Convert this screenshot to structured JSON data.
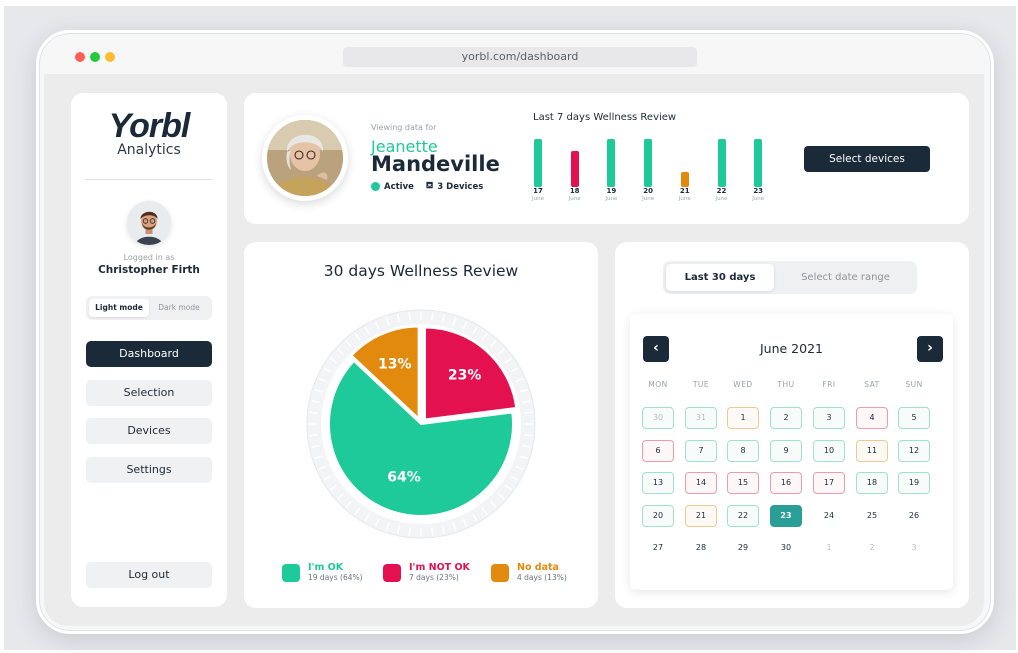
{
  "browser": {
    "url": "yorbl.com/dashboard"
  },
  "colors": {
    "ok": "#1ec99a",
    "not_ok": "#e3114f",
    "no_data": "#e18a0d",
    "navy": "#1b2a38",
    "today": "#2a9f97"
  },
  "sidebar": {
    "logo_mark": "Yorbl",
    "logo_sub": "Analytics",
    "logged_label": "Logged in as",
    "user_name": "Christopher Firth",
    "modes": {
      "light": "Light mode",
      "dark": "Dark mode",
      "selected": "light"
    },
    "nav": [
      {
        "label": "Dashboard",
        "active": true
      },
      {
        "label": "Selection",
        "active": false
      },
      {
        "label": "Devices",
        "active": false
      },
      {
        "label": "Settings",
        "active": false
      }
    ],
    "logout": "Log out"
  },
  "profile": {
    "viewing_label": "Viewing data for",
    "first_name": "Jeanette",
    "last_name": "Mandeville",
    "status": "Active",
    "devices": "3 Devices"
  },
  "week_review": {
    "title": "Last 7 days Wellness Review",
    "days": [
      {
        "day": "17",
        "month": "June",
        "status": "ok"
      },
      {
        "day": "18",
        "month": "June",
        "status": "not_ok"
      },
      {
        "day": "19",
        "month": "June",
        "status": "ok"
      },
      {
        "day": "20",
        "month": "June",
        "status": "ok"
      },
      {
        "day": "21",
        "month": "June",
        "status": "no_data"
      },
      {
        "day": "22",
        "month": "June",
        "status": "ok"
      },
      {
        "day": "23",
        "month": "June",
        "status": "ok"
      }
    ],
    "select_devices": "Select devices"
  },
  "chart_data": {
    "type": "pie",
    "title": "30 days Wellness Review",
    "slices": [
      {
        "label": "I'm OK",
        "value": 64,
        "display": "64%",
        "sub": "19 days (64%)",
        "color": "#1ec99a"
      },
      {
        "label": "I'm NOT OK",
        "value": 23,
        "display": "23%",
        "sub": "7 days (23%)",
        "color": "#e3114f"
      },
      {
        "label": "No data",
        "value": 13,
        "display": "13%",
        "sub": "4 days (13%)",
        "color": "#e18a0d"
      }
    ]
  },
  "calendar": {
    "range_active": "Last 30 days",
    "range_other": "Select date range",
    "month": "June 2021",
    "weekdays": [
      "MON",
      "TUE",
      "WED",
      "THU",
      "FRI",
      "SAT",
      "SUN"
    ],
    "weeks": [
      [
        {
          "d": "30",
          "s": "ok",
          "m": true
        },
        {
          "d": "31",
          "s": "ok",
          "m": true
        },
        {
          "d": "1",
          "s": "nodata"
        },
        {
          "d": "2",
          "s": "ok"
        },
        {
          "d": "3",
          "s": "ok"
        },
        {
          "d": "4",
          "s": "notok"
        },
        {
          "d": "5",
          "s": "ok"
        }
      ],
      [
        {
          "d": "6",
          "s": "notok"
        },
        {
          "d": "7",
          "s": "ok"
        },
        {
          "d": "8",
          "s": "ok"
        },
        {
          "d": "9",
          "s": "ok"
        },
        {
          "d": "10",
          "s": "ok"
        },
        {
          "d": "11",
          "s": "nodata"
        },
        {
          "d": "12",
          "s": "ok"
        }
      ],
      [
        {
          "d": "13",
          "s": "ok"
        },
        {
          "d": "14",
          "s": "notok"
        },
        {
          "d": "15",
          "s": "notok"
        },
        {
          "d": "16",
          "s": "notok"
        },
        {
          "d": "17",
          "s": "notok"
        },
        {
          "d": "18",
          "s": "ok"
        },
        {
          "d": "19",
          "s": "ok"
        }
      ],
      [
        {
          "d": "20",
          "s": "ok"
        },
        {
          "d": "21",
          "s": "nodata"
        },
        {
          "d": "22",
          "s": "ok"
        },
        {
          "d": "23",
          "s": "today"
        },
        {
          "d": "24",
          "s": "plain"
        },
        {
          "d": "25",
          "s": "plain"
        },
        {
          "d": "26",
          "s": "plain"
        }
      ],
      [
        {
          "d": "27",
          "s": "plain"
        },
        {
          "d": "28",
          "s": "plain"
        },
        {
          "d": "29",
          "s": "plain"
        },
        {
          "d": "30",
          "s": "plain"
        },
        {
          "d": "1",
          "s": "plain",
          "m": true
        },
        {
          "d": "2",
          "s": "plain",
          "m": true
        },
        {
          "d": "3",
          "s": "plain",
          "m": true
        }
      ]
    ]
  }
}
